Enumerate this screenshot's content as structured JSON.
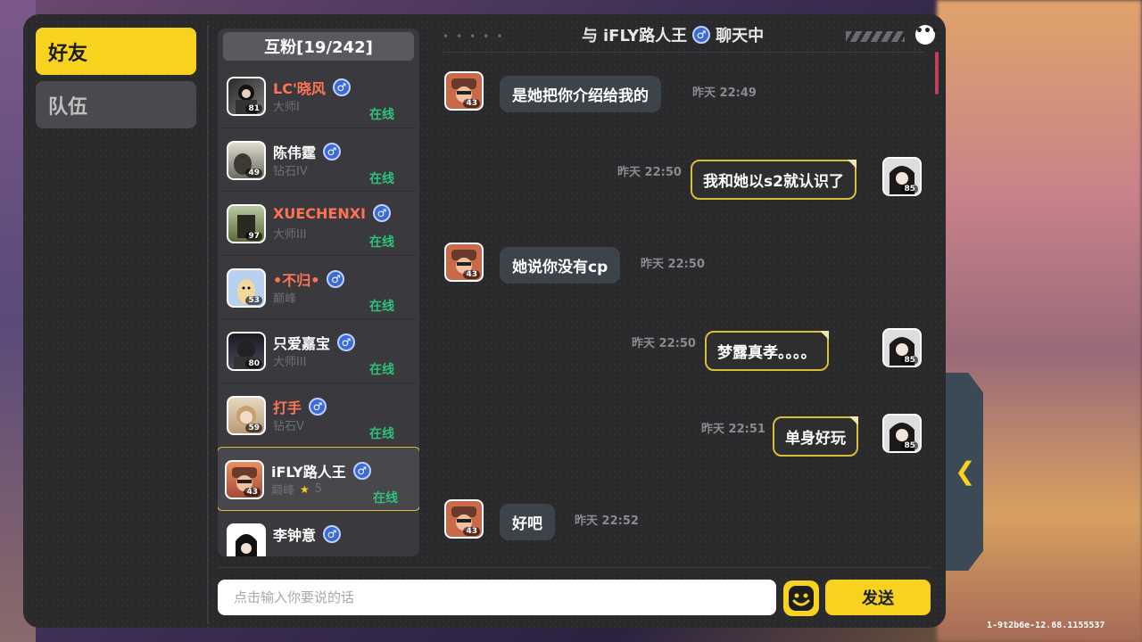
{
  "tabs": {
    "friends": "好友",
    "team": "队伍"
  },
  "friend_list": {
    "header": "互粉[19/242]",
    "items": [
      {
        "name": "LC'晓风",
        "rank": "大师I",
        "level": "81",
        "status": "在线",
        "name_color": "red"
      },
      {
        "name": "陈伟霆",
        "rank": "钻石IV",
        "level": "49",
        "status": "在线",
        "name_color": "white"
      },
      {
        "name": "XUECHENXI",
        "rank": "大师III",
        "level": "97",
        "status": "在线",
        "name_color": "red"
      },
      {
        "name": "•不归•",
        "rank": "巅峰",
        "level": "53",
        "status": "在线",
        "name_color": "red"
      },
      {
        "name": "只爱嘉宝",
        "rank": "大师III",
        "level": "80",
        "status": "在线",
        "name_color": "white"
      },
      {
        "name": "打手",
        "rank": "钻石V",
        "level": "59",
        "status": "在线",
        "name_color": "red"
      },
      {
        "name": "iFLY路人王",
        "rank": "巅峰",
        "rank_stars": "5",
        "level": "43",
        "status": "在线",
        "name_color": "white",
        "selected": true
      },
      {
        "name": "李钟意",
        "rank": "",
        "level": "",
        "status": "",
        "name_color": "white"
      }
    ]
  },
  "chat": {
    "title_prefix": "与",
    "title_name": "iFLY路人王",
    "title_suffix": "聊天中",
    "messages": [
      {
        "side": "in",
        "text": "是她把你介绍给我的",
        "time": "昨天 22:49",
        "level": "43"
      },
      {
        "side": "out",
        "text": "我和她以s2就认识了",
        "time": "昨天 22:50",
        "level": "85"
      },
      {
        "side": "in",
        "text": "她说你没有cp",
        "time": "昨天 22:50",
        "level": "43"
      },
      {
        "side": "out",
        "text": "梦露真孝。。。。",
        "time": "昨天 22:50",
        "level": "85"
      },
      {
        "side": "out",
        "text": "单身好玩",
        "time": "昨天 22:51",
        "level": "85"
      },
      {
        "side": "in",
        "text": "好吧",
        "time": "昨天 22:52",
        "level": "43"
      }
    ]
  },
  "input": {
    "placeholder": "点击输入你要说的话",
    "value": ""
  },
  "send_label": "发送",
  "version": "1-9t2b6e-12.68.1155537",
  "colors": {
    "accent_yellow": "#f7d21e",
    "online_green": "#2fc07c",
    "name_red": "#ff7355",
    "gender_blue": "#3d6bd6"
  },
  "icons": {
    "gender": "male-icon",
    "emoji": "smiley-icon",
    "more": "more-icon",
    "side": "chevron-left-icon"
  }
}
